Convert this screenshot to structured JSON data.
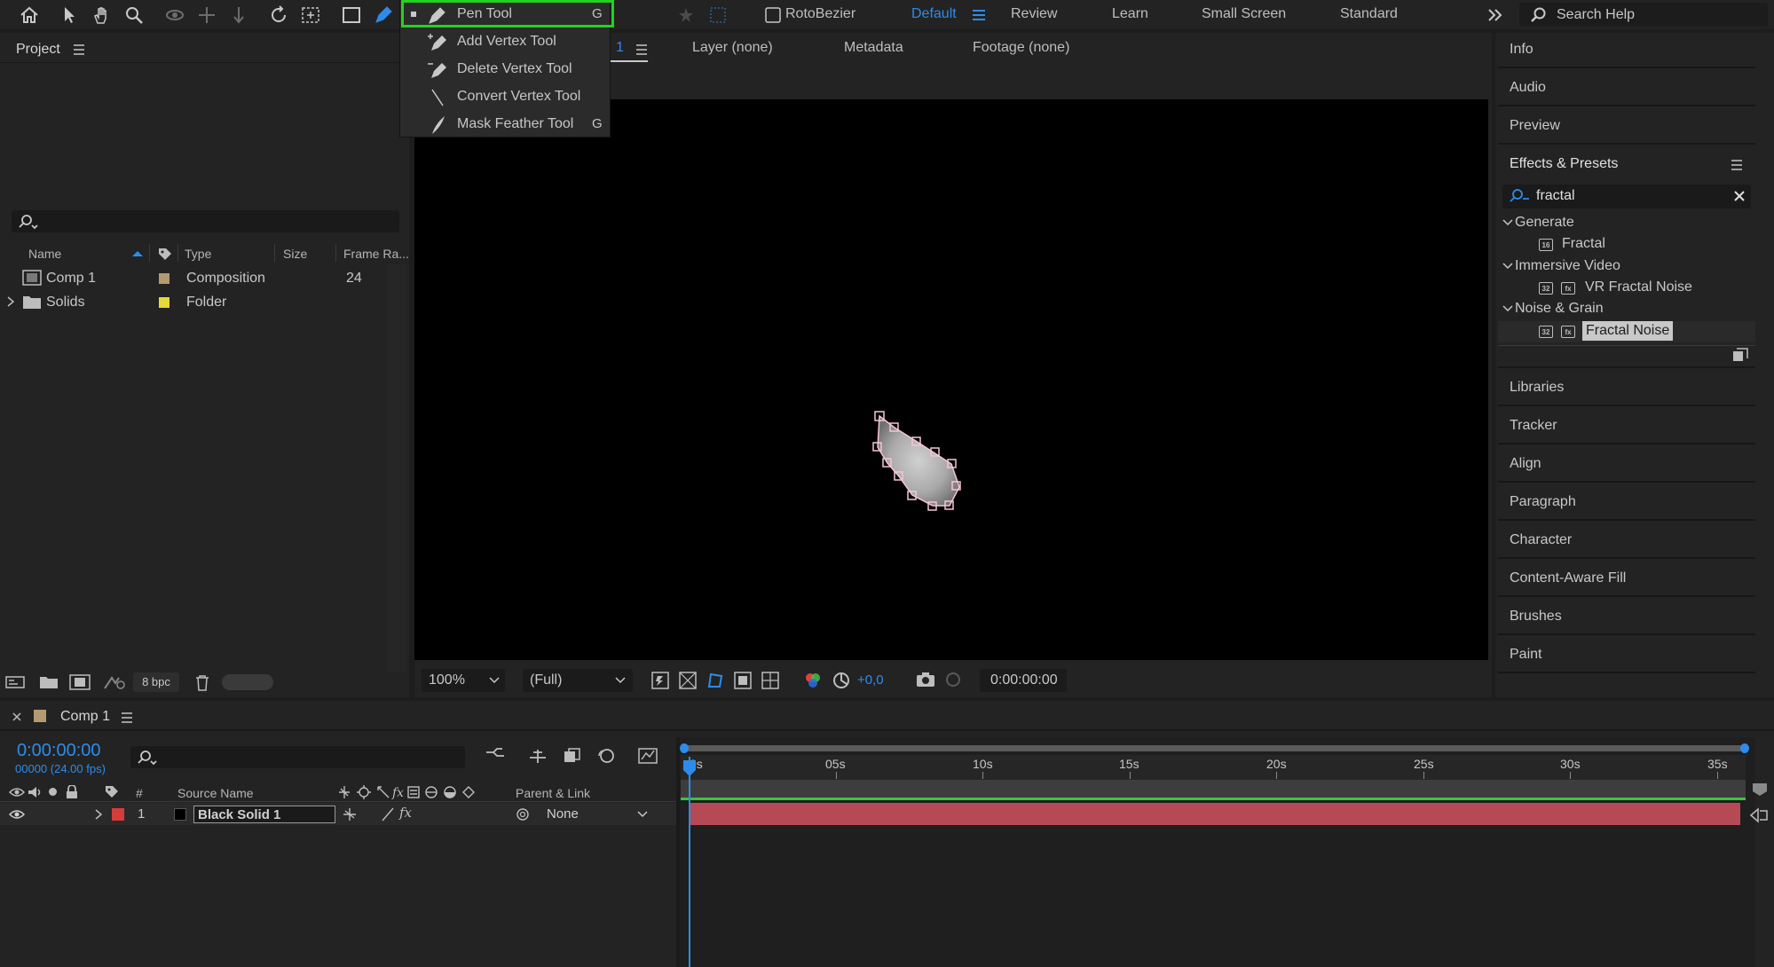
{
  "toolbar": {
    "rotobezier_label": "RotoBezier",
    "workspaces": [
      "Default",
      "Review",
      "Learn",
      "Small Screen",
      "Standard"
    ],
    "search_help_placeholder": "Search Help"
  },
  "tool_menu": {
    "items": [
      {
        "label": "Pen Tool",
        "key": "G"
      },
      {
        "label": "Add Vertex Tool",
        "key": ""
      },
      {
        "label": "Delete Vertex Tool",
        "key": ""
      },
      {
        "label": "Convert Vertex Tool",
        "key": ""
      },
      {
        "label": "Mask Feather Tool",
        "key": "G"
      }
    ]
  },
  "project": {
    "title": "Project",
    "columns": {
      "name": "Name",
      "type": "Type",
      "size": "Size",
      "frame_rate": "Frame Ra..."
    },
    "rows": [
      {
        "name": "Comp 1",
        "type": "Composition",
        "frame_rate": "24",
        "label_color": "#b49a70"
      },
      {
        "name": "Solids",
        "type": "Folder",
        "frame_rate": "",
        "label_color": "#e6d838"
      }
    ],
    "bpc": "8 bpc"
  },
  "viewer": {
    "comp_tab_fragment": "1",
    "tabs": [
      "Layer (none)",
      "Metadata",
      "Footage (none)"
    ],
    "zoom": "100%",
    "resolution": "(Full)",
    "exposure": "+0,0",
    "timecode": "0:00:00:00"
  },
  "right_panel": {
    "top_items": [
      "Info",
      "Audio",
      "Preview"
    ],
    "effects_title": "Effects & Presets",
    "effects_search_value": "fractal",
    "tree": {
      "generate": {
        "label": "Generate",
        "items": [
          "Fractal"
        ]
      },
      "immersive": {
        "label": "Immersive Video",
        "items": [
          "VR Fractal Noise"
        ]
      },
      "noise": {
        "label": "Noise & Grain",
        "items": [
          "Fractal Noise"
        ]
      }
    },
    "bottom_items": [
      "Libraries",
      "Tracker",
      "Align",
      "Paragraph",
      "Character",
      "Content-Aware Fill",
      "Brushes",
      "Paint"
    ]
  },
  "timeline": {
    "comp_name": "Comp 1",
    "current_time": "0:00:00:00",
    "frame_info": "00000 (24.00 fps)",
    "ruler": [
      "0s",
      "05s",
      "10s",
      "15s",
      "20s",
      "25s",
      "30s",
      "35s"
    ],
    "columns": {
      "number": "#",
      "source_name": "Source Name",
      "parent": "Parent & Link"
    },
    "layer": {
      "number": "1",
      "name": "Black Solid 1",
      "parent": "None",
      "label_color": "#d63c3c",
      "bar_color": "#b54a55"
    }
  }
}
